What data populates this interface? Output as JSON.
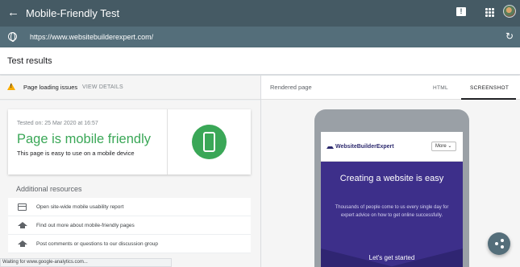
{
  "app": {
    "title": "Mobile-Friendly Test",
    "back_icon": "←",
    "feedback_icon": "!"
  },
  "urlbar": {
    "url": "https://www.websitebuilderexpert.com/",
    "reload_icon": "↻"
  },
  "results": {
    "heading": "Test results"
  },
  "issues": {
    "label": "Page loading issues",
    "link": "VIEW DETAILS"
  },
  "summary": {
    "tested_on": "Tested on: 25 Mar 2020 at 16:57",
    "verdict": "Page is mobile friendly",
    "description": "This page is easy to use on a mobile device"
  },
  "additional": {
    "heading": "Additional resources",
    "items": [
      {
        "icon": "window-icon",
        "label": "Open site-wide mobile usability report"
      },
      {
        "icon": "school-icon",
        "label": "Find out more about mobile-friendly pages"
      },
      {
        "icon": "school-icon",
        "label": "Post comments or questions to our discussion group"
      }
    ]
  },
  "rendered": {
    "label": "Rendered page",
    "tabs": [
      {
        "label": "HTML",
        "active": false
      },
      {
        "label": "SCREENSHOT",
        "active": true
      }
    ]
  },
  "preview": {
    "logo": "WebsiteBuilderExpert",
    "menu_button": "More ⌄",
    "hero_title": "Creating a website is easy",
    "hero_text": "Thousands of people come to us every single day for expert advice on how to get online successfully.",
    "cta": "Let's get started"
  },
  "status": {
    "text": "Waiting for www.google-analytics.com..."
  },
  "colors": {
    "topbar": "#455a64",
    "success": "#3aa757",
    "warning": "#f9ab00",
    "hero": "#3d2f8a"
  }
}
